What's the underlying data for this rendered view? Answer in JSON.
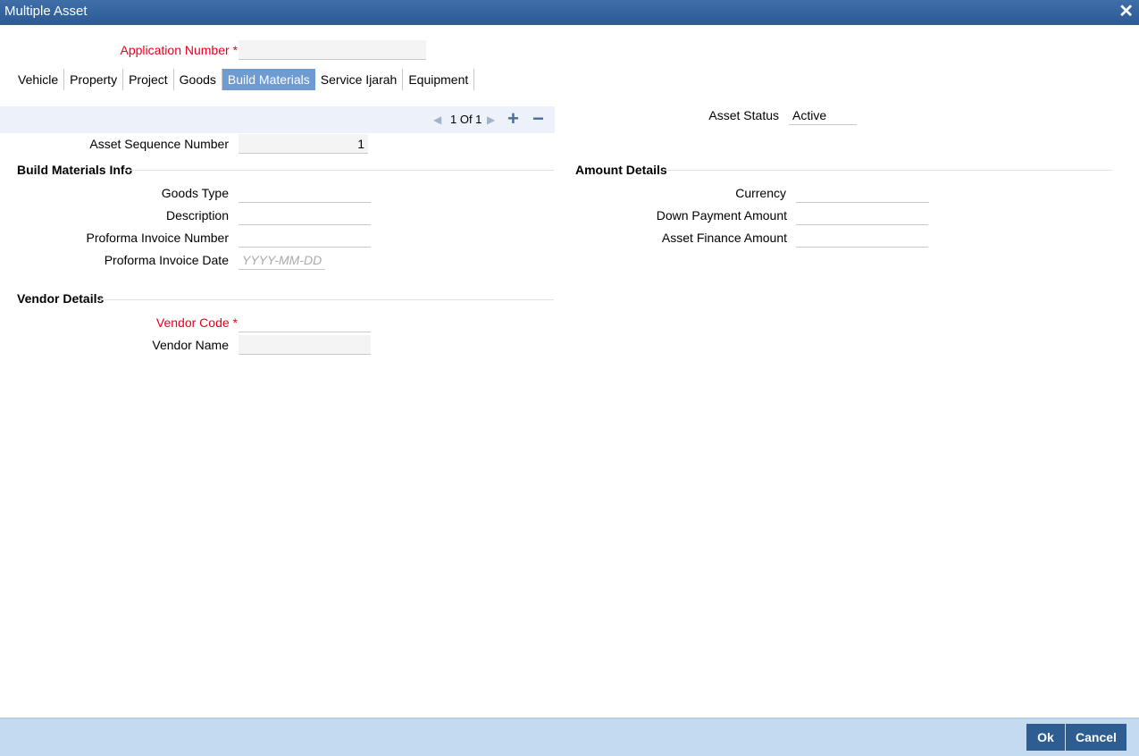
{
  "window": {
    "title": "Multiple Asset",
    "close_glyph": "✕"
  },
  "application": {
    "label": "Application Number",
    "required_mark": "*",
    "value": ""
  },
  "tabs": [
    {
      "label": "Vehicle"
    },
    {
      "label": "Property"
    },
    {
      "label": "Project"
    },
    {
      "label": "Goods"
    },
    {
      "label": "Build Materials",
      "active": true
    },
    {
      "label": "Service Ijarah"
    },
    {
      "label": "Equipment"
    }
  ],
  "pager": {
    "text": "1 Of 1",
    "prev_glyph": "◀",
    "next_glyph": "▶",
    "add_glyph": "+",
    "remove_glyph": "−"
  },
  "asset_status": {
    "label": "Asset Status",
    "value": "Active"
  },
  "asset_sequence": {
    "label": "Asset Sequence Number",
    "value": "1"
  },
  "build_materials_info": {
    "title": "Build Materials Info",
    "goods_type": {
      "label": "Goods Type",
      "value": ""
    },
    "description": {
      "label": "Description",
      "value": ""
    },
    "proforma_invoice_number": {
      "label": "Proforma Invoice Number",
      "value": ""
    },
    "proforma_invoice_date": {
      "label": "Proforma Invoice Date",
      "placeholder": "YYYY-MM-DD"
    }
  },
  "amount_details": {
    "title": "Amount Details",
    "currency": {
      "label": "Currency",
      "value": ""
    },
    "down_payment": {
      "label": "Down Payment Amount",
      "value": ""
    },
    "asset_finance": {
      "label": "Asset Finance Amount",
      "value": ""
    }
  },
  "vendor_details": {
    "title": "Vendor Details",
    "vendor_code": {
      "label": "Vendor Code",
      "required_mark": "*",
      "value": ""
    },
    "vendor_name": {
      "label": "Vendor Name",
      "value": ""
    }
  },
  "footer": {
    "ok_label": "Ok",
    "cancel_label": "Cancel"
  },
  "colors": {
    "title_bar": "#2b5a94",
    "active_tab": "#6f9bd1",
    "required": "#e8001c",
    "footer": "#c3daf0",
    "button": "#2d5d91"
  }
}
